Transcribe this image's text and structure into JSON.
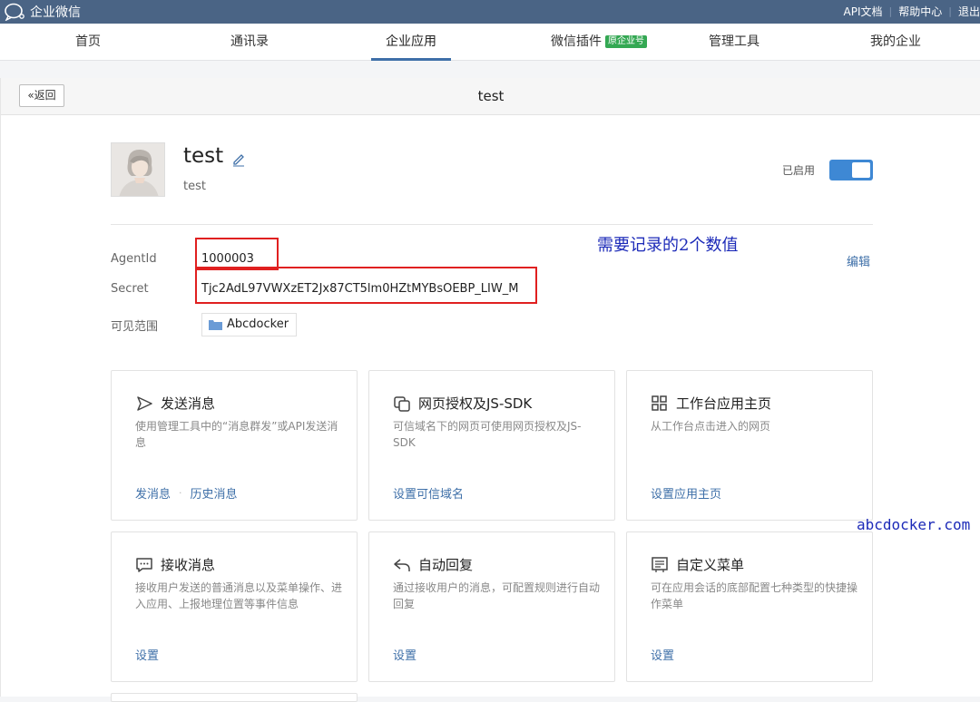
{
  "topbar": {
    "brand": "企业微信",
    "links": [
      "API文档",
      "帮助中心",
      "退出"
    ]
  },
  "nav": {
    "items": [
      {
        "label": "首页"
      },
      {
        "label": "通讯录"
      },
      {
        "label": "企业应用",
        "active": true
      },
      {
        "label": "微信插件",
        "badge": "原企业号"
      },
      {
        "label": "管理工具"
      },
      {
        "label": "我的企业"
      }
    ]
  },
  "panel": {
    "back_label": "返回",
    "title": "test"
  },
  "app": {
    "name": "test",
    "description": "test",
    "status_label": "已启用",
    "enabled": true
  },
  "details": {
    "agentid_label": "AgentId",
    "agentid_value": "1000003",
    "secret_label": "Secret",
    "secret_value": "Tjc2AdL97VWXzET2Jx87CT5lm0HZtMYBsOEBP_LIW_M",
    "scope_label": "可见范围",
    "scope_value": "Abcdocker",
    "edit_label": "编辑",
    "annotation": "需要记录的2个数值"
  },
  "cards": [
    {
      "icon": "send-icon",
      "title": "发送消息",
      "desc": "使用管理工具中的“消息群发”或API发送消息",
      "links": [
        "发消息",
        "历史消息"
      ]
    },
    {
      "icon": "copy-auth-icon",
      "title": "网页授权及JS-SDK",
      "desc": "可信域名下的网页可使用网页授权及JS-SDK",
      "links": [
        "设置可信域名"
      ]
    },
    {
      "icon": "grid-icon",
      "title": "工作台应用主页",
      "desc": "从工作台点击进入的网页",
      "links": [
        "设置应用主页"
      ]
    },
    {
      "icon": "chat-icon",
      "title": "接收消息",
      "desc": "接收用户发送的普通消息以及菜单操作、进入应用、上报地理位置等事件信息",
      "links": [
        "设置"
      ]
    },
    {
      "icon": "reply-icon",
      "title": "自动回复",
      "desc": "通过接收用户的消息，可配置规则进行自动回复",
      "links": [
        "设置"
      ]
    },
    {
      "icon": "menu-icon",
      "title": "自定义菜单",
      "desc": "可在应用会话的底部配置七种类型的快捷操作菜单",
      "links": [
        "设置"
      ]
    }
  ],
  "watermark": "abcdocker.com",
  "colors": {
    "topbar": "#4a6485",
    "accent": "#3e6fa8",
    "toggle": "#3e88d4",
    "highlight": "#e02020"
  }
}
